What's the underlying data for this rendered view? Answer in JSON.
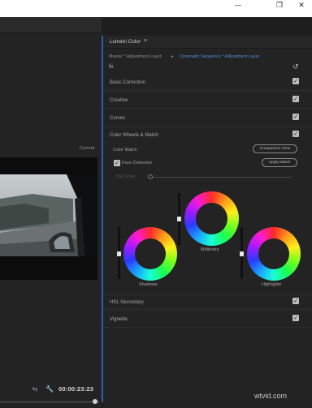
{
  "window": {
    "minimize_glyph": "—",
    "maximize_glyph": "❐",
    "close_glyph": "✕"
  },
  "monitor": {
    "current_label": "Current",
    "timecode": "00:00:23:23",
    "controls": [
      "swap-icon",
      "wrench-icon"
    ]
  },
  "lumetri": {
    "tab_title": "Lumetri Color",
    "tab_menu_glyph": "≡",
    "clip_master": "Master * Adjustment Layer",
    "clip_arrow": "▸",
    "clip_sequence": "Cinematic Sequence * Adjustment Layer",
    "fx_glyph": "fx",
    "reset_glyph": "↺",
    "sections": {
      "basic": "Basic Correction",
      "creative": "Creative",
      "curves": "Curves",
      "wheels": "Color Wheels & Match",
      "hsl": "HSL Secondary",
      "vignette": "Vignette"
    },
    "color_match_label": "Color Match",
    "comparison_view_label": "Comparison View",
    "face_detection_label": "Face Detection",
    "apply_match_label": "Apply Match",
    "hue_label": "Hue Scale",
    "wheels": {
      "shadows": "Shadows",
      "midtones": "Midtones",
      "highlights": "Highlights"
    },
    "check_glyph": "✓"
  },
  "watermark": "wtvid.com"
}
